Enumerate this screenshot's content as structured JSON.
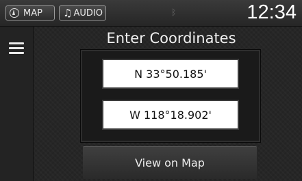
{
  "topbar": {
    "map_label": "MAP",
    "audio_label": "AUDIO",
    "clock": "12:34",
    "icons": {
      "map": "navigation-arrow-icon",
      "audio": "music-note-icon",
      "status": "bluetooth-icon"
    }
  },
  "menu": {
    "icon": "hamburger-menu-icon"
  },
  "page": {
    "title": "Enter Coordinates"
  },
  "coordinates": {
    "latitude": "N 33°50.185'",
    "longitude": "W 118°18.902'"
  },
  "actions": {
    "view_on_map_label": "View on Map"
  },
  "colors": {
    "background": "#262626",
    "field_background": "#ffffff",
    "text": "#ffffff"
  }
}
